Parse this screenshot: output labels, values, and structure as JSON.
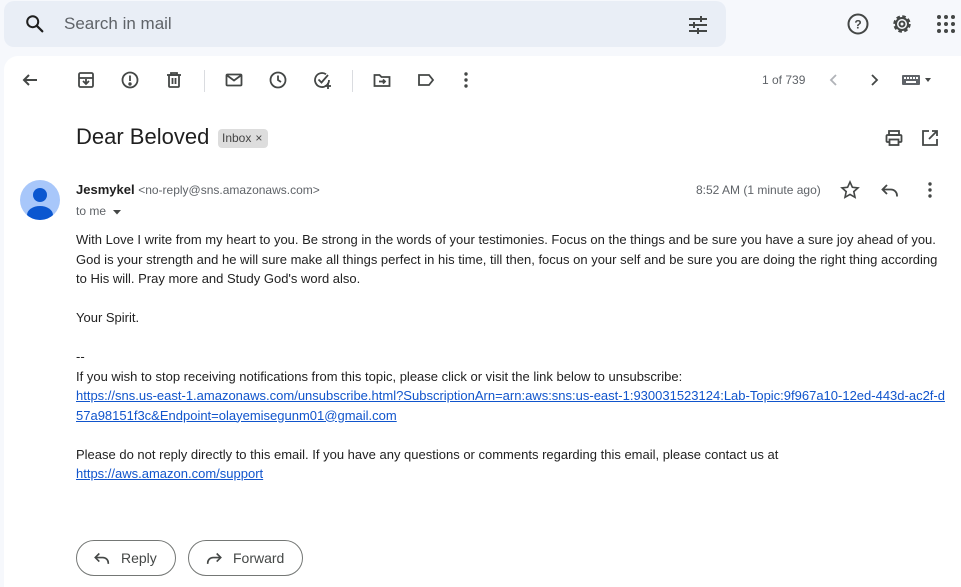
{
  "search": {
    "placeholder": "Search in mail"
  },
  "toolbar": {
    "count": "1 of 739"
  },
  "message": {
    "subject": "Dear Beloved",
    "label": "Inbox",
    "label_remove": "×",
    "sender_name": "Jesmykel",
    "sender_email": "<no-reply@sns.amazonaws.com>",
    "to": "to me",
    "time": "8:52 AM (1 minute ago)",
    "paragraph1": "With Love I write from my heart to you. Be strong in the words of your testimonies. Focus on the things and be sure you have a sure joy ahead of you. God is your strength and he will sure make all things perfect in his time, till then, focus on your self and be sure you are doing the right thing according to His will. Pray more and Study God's word also.",
    "paragraph2": "Your Spirit.",
    "separator": "--",
    "unsubscribe_text": "If you wish to stop receiving notifications from this topic, please click or visit the link below to unsubscribe:",
    "unsubscribe_link": "https://sns.us-east-1.amazonaws.com/unsubscribe.html?SubscriptionArn=arn:aws:sns:us-east-1:930031523124:Lab-Topic:9f967a10-12ed-443d-ac2f-d57a98151f3c&Endpoint=olayemisegunm01@gmail.com",
    "noreply_text": "Please do not reply directly to this email. If you have any questions or comments regarding this email, please contact us at",
    "support_link": "https://aws.amazon.com/support"
  },
  "actions": {
    "reply": "Reply",
    "forward": "Forward"
  }
}
